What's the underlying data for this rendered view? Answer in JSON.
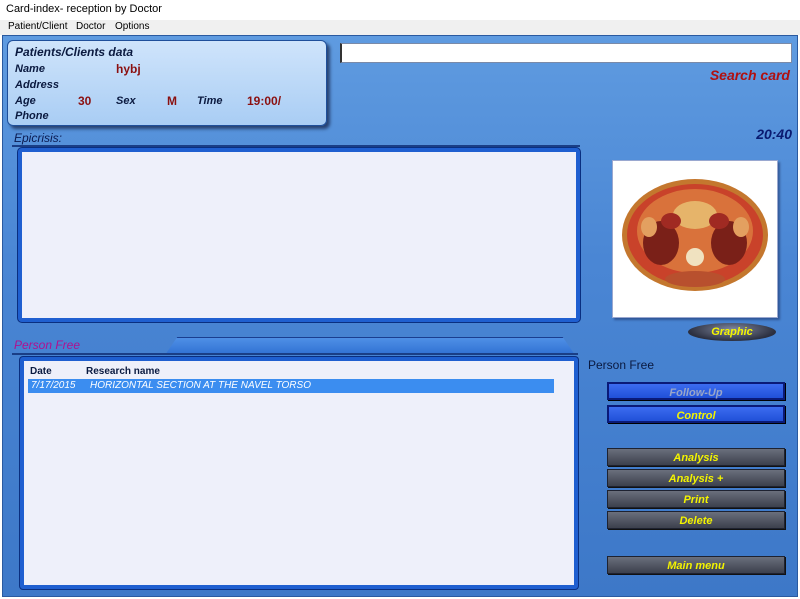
{
  "window": {
    "title": "Card-index- reception by Doctor"
  },
  "menu": [
    {
      "label": "Patient/Client"
    },
    {
      "label": "Doctor"
    },
    {
      "label": "Options"
    }
  ],
  "patient": {
    "heading": "Patients/Clients data",
    "name_label": "Name",
    "name_value": "hybj",
    "address_label": "Address",
    "age_label": "Age",
    "age_value": "30",
    "sex_label": "Sex",
    "sex_value": "M",
    "time_label": "Time",
    "time_value": "19:00/",
    "phone_label": "Phone"
  },
  "search": {
    "label": "Search card",
    "value": ""
  },
  "clock": "20:40",
  "epicrisis": {
    "label": "Epicrisis:",
    "text": ""
  },
  "graphic": {
    "button_label": "Graphic",
    "image_icon": "anatomy-section-image"
  },
  "person_free": {
    "label": "Person Free",
    "right_label": "Person Free",
    "columns": [
      "Date",
      "Research name"
    ],
    "rows": [
      {
        "date": "7/17/2015",
        "name": "HORIZONTAL SECTION AT THE NAVEL TORSO"
      }
    ]
  },
  "buttons": {
    "follow_up": "Follow-Up",
    "control": "Control",
    "analysis": "Analysis",
    "analysis_plus": "Analysis +",
    "print": "Print",
    "delete": "Delete",
    "main_menu": "Main menu"
  },
  "colors": {
    "accent_blue": "#2050d8",
    "dark_button": "#3c404c",
    "button_text_yellow": "#f4f400",
    "value_red": "#8b1010",
    "search_red": "#b01010"
  }
}
